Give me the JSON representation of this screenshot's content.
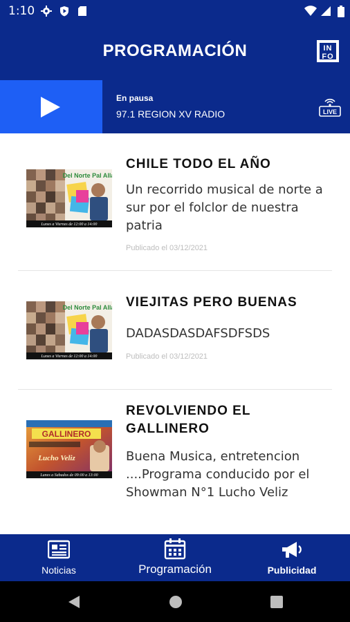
{
  "status_bar": {
    "time": "1:10",
    "icons": [
      "gear-icon",
      "shield-play-icon",
      "sd-card-icon",
      "wifi-icon",
      "signal-icon",
      "battery-icon"
    ]
  },
  "app_bar": {
    "title": "PROGRAMACIÓN",
    "info_label_top": "IN",
    "info_label_bottom": "FO"
  },
  "player": {
    "status": "En pausa",
    "station": "97.1 REGION XV RADIO",
    "live_label": "LIVE"
  },
  "programs": [
    {
      "title": "CHILE TODO EL AÑO",
      "description": "Un recorrido musical de norte a sur por el folclor de nuestra patria",
      "date": "Publicado el 03/12/2021",
      "thumb_caption": "Lunes a Viernes de 12:00 a 14:00",
      "thumb_heading": "Del Norte Pal Allá"
    },
    {
      "title": "VIEJITAS PERO BUENAS",
      "description": "DADASDASDAFSDFSDS",
      "date": "Publicado el 03/12/2021",
      "thumb_caption": "Lunes a Viernes de 12:00 a 14:00",
      "thumb_heading": "Del Norte Pal Allá"
    },
    {
      "title": "REVOLVIENDO EL GALLINERO",
      "description": "Buena Musica, entretencion  ....Programa conducido por el Showman N°1 Lucho Veliz",
      "date": "",
      "thumb_caption": "Lunes a Sabados de 09:00 a 13:00",
      "thumb_heading": "GALLINERO",
      "thumb_sub": "Lucho Veliz"
    }
  ],
  "bottom_nav": {
    "items": [
      {
        "label": "Noticias",
        "icon": "newspaper-icon"
      },
      {
        "label": "Programación",
        "icon": "calendar-icon"
      },
      {
        "label": "Publicidad",
        "icon": "megaphone-icon"
      }
    ]
  },
  "colors": {
    "primary": "#0b2a8c",
    "accent": "#1e5ff5"
  }
}
